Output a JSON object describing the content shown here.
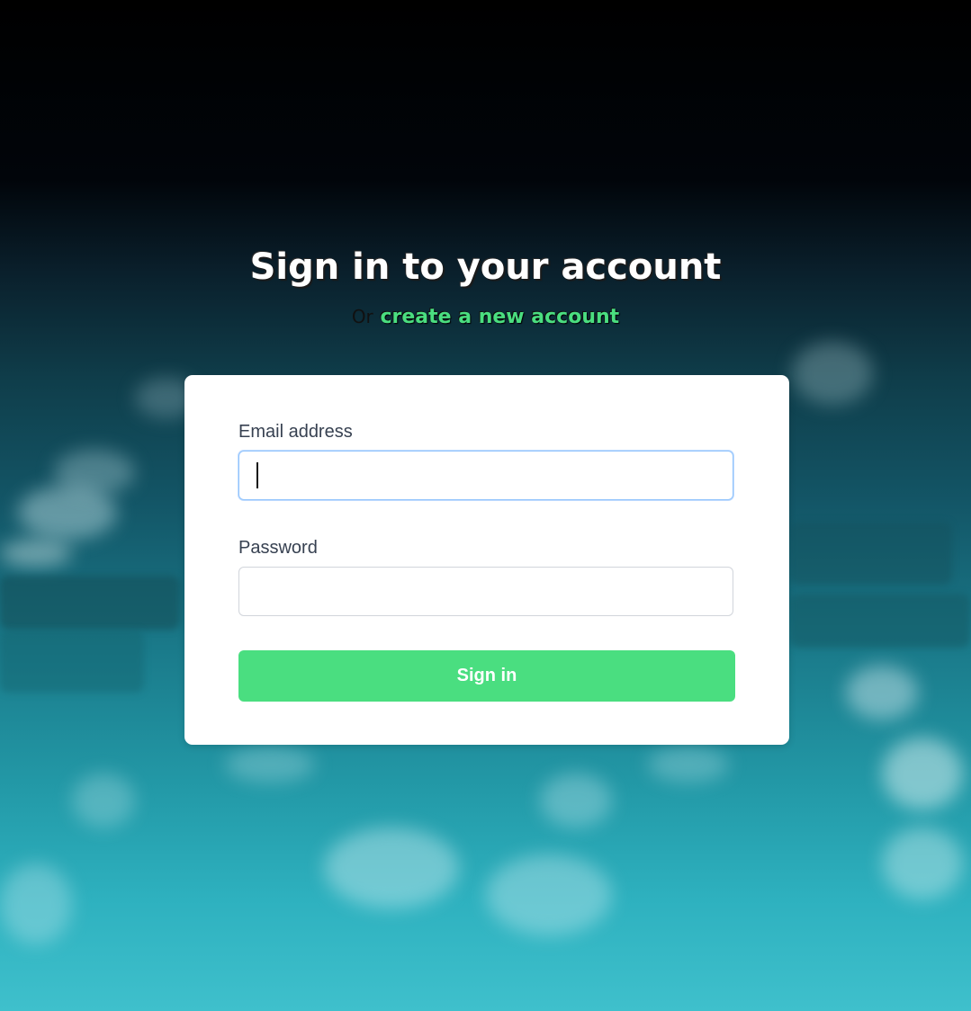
{
  "page": {
    "heading": "Sign in to your account",
    "subline_prefix": "Or",
    "create_account_link": "create a new account"
  },
  "form": {
    "email_label": "Email address",
    "email_value": "",
    "password_label": "Password",
    "password_value": "",
    "submit_label": "Sign in"
  },
  "colors": {
    "accent": "#4ade80",
    "card_background": "#ffffff",
    "label_text": "#374151",
    "focus_border": "#93c5fd"
  }
}
